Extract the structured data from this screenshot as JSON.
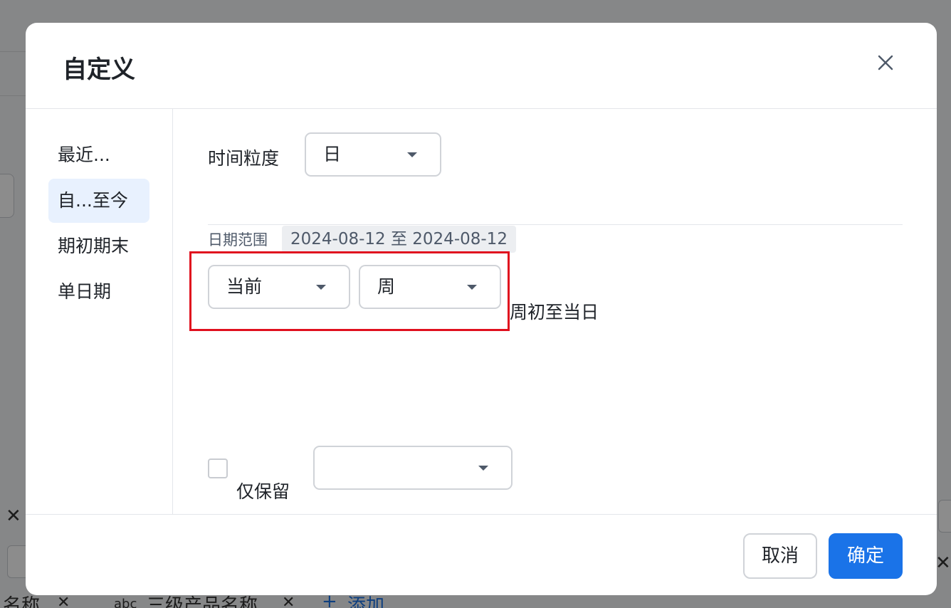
{
  "background": {
    "bottom_row": {
      "tag_1_text": "名称",
      "tag_2_type": "abc",
      "tag_2_text": "三级产品名称",
      "add_label": "添加"
    }
  },
  "dialog": {
    "title": "自定义",
    "sidebar": {
      "items": [
        {
          "label": "最近...",
          "active": false
        },
        {
          "label": "自...至今",
          "active": true
        },
        {
          "label": "期初期末",
          "active": false
        },
        {
          "label": "单日期",
          "active": false
        }
      ]
    },
    "granularity": {
      "label": "时间粒度",
      "value": "日"
    },
    "date_range": {
      "label": "日期范围",
      "value": "2024-08-12 至 2024-08-12"
    },
    "period": {
      "relative_value": "当前",
      "unit_value": "周",
      "description": "周初至当日"
    },
    "keep_only": {
      "label": "仅保留",
      "checked": false,
      "value": ""
    },
    "footer": {
      "cancel_label": "取消",
      "ok_label": "确定"
    }
  },
  "colors": {
    "primary": "#1a73e8",
    "highlight_border": "#e0101e",
    "active_sidebar_bg": "#e8f1fe"
  }
}
